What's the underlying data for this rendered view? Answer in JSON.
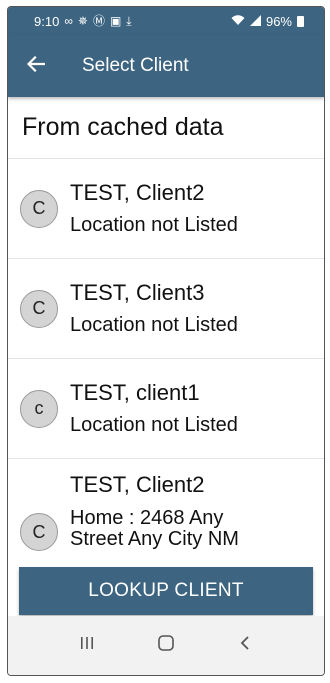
{
  "status_bar": {
    "time": "9:10",
    "left_icons": [
      "voicemail-icon",
      "pinwheel-icon",
      "circle-icon",
      "image-icon",
      "download-icon"
    ],
    "battery_percent": "96%"
  },
  "app_bar": {
    "title": "Select Client",
    "back_icon": "arrow-left-icon"
  },
  "section": {
    "header": "From cached data"
  },
  "clients": [
    {
      "initial": "C",
      "name": "TEST, Client2",
      "location": "Location not Listed"
    },
    {
      "initial": "C",
      "name": "TEST, Client3",
      "location": "Location not Listed"
    },
    {
      "initial": "c",
      "name": "TEST, client1",
      "location": "Location not Listed"
    },
    {
      "initial": "C",
      "name": "TEST, Client2",
      "location": "Home : 2468 Any Street Any City NM"
    }
  ],
  "lookup": {
    "label": "LOOKUP CLIENT"
  },
  "colors": {
    "primary": "#3d6480",
    "avatar_bg": "#d4d4d4"
  },
  "nav": {
    "icons": [
      "recent-apps-icon",
      "home-icon",
      "back-icon"
    ]
  }
}
